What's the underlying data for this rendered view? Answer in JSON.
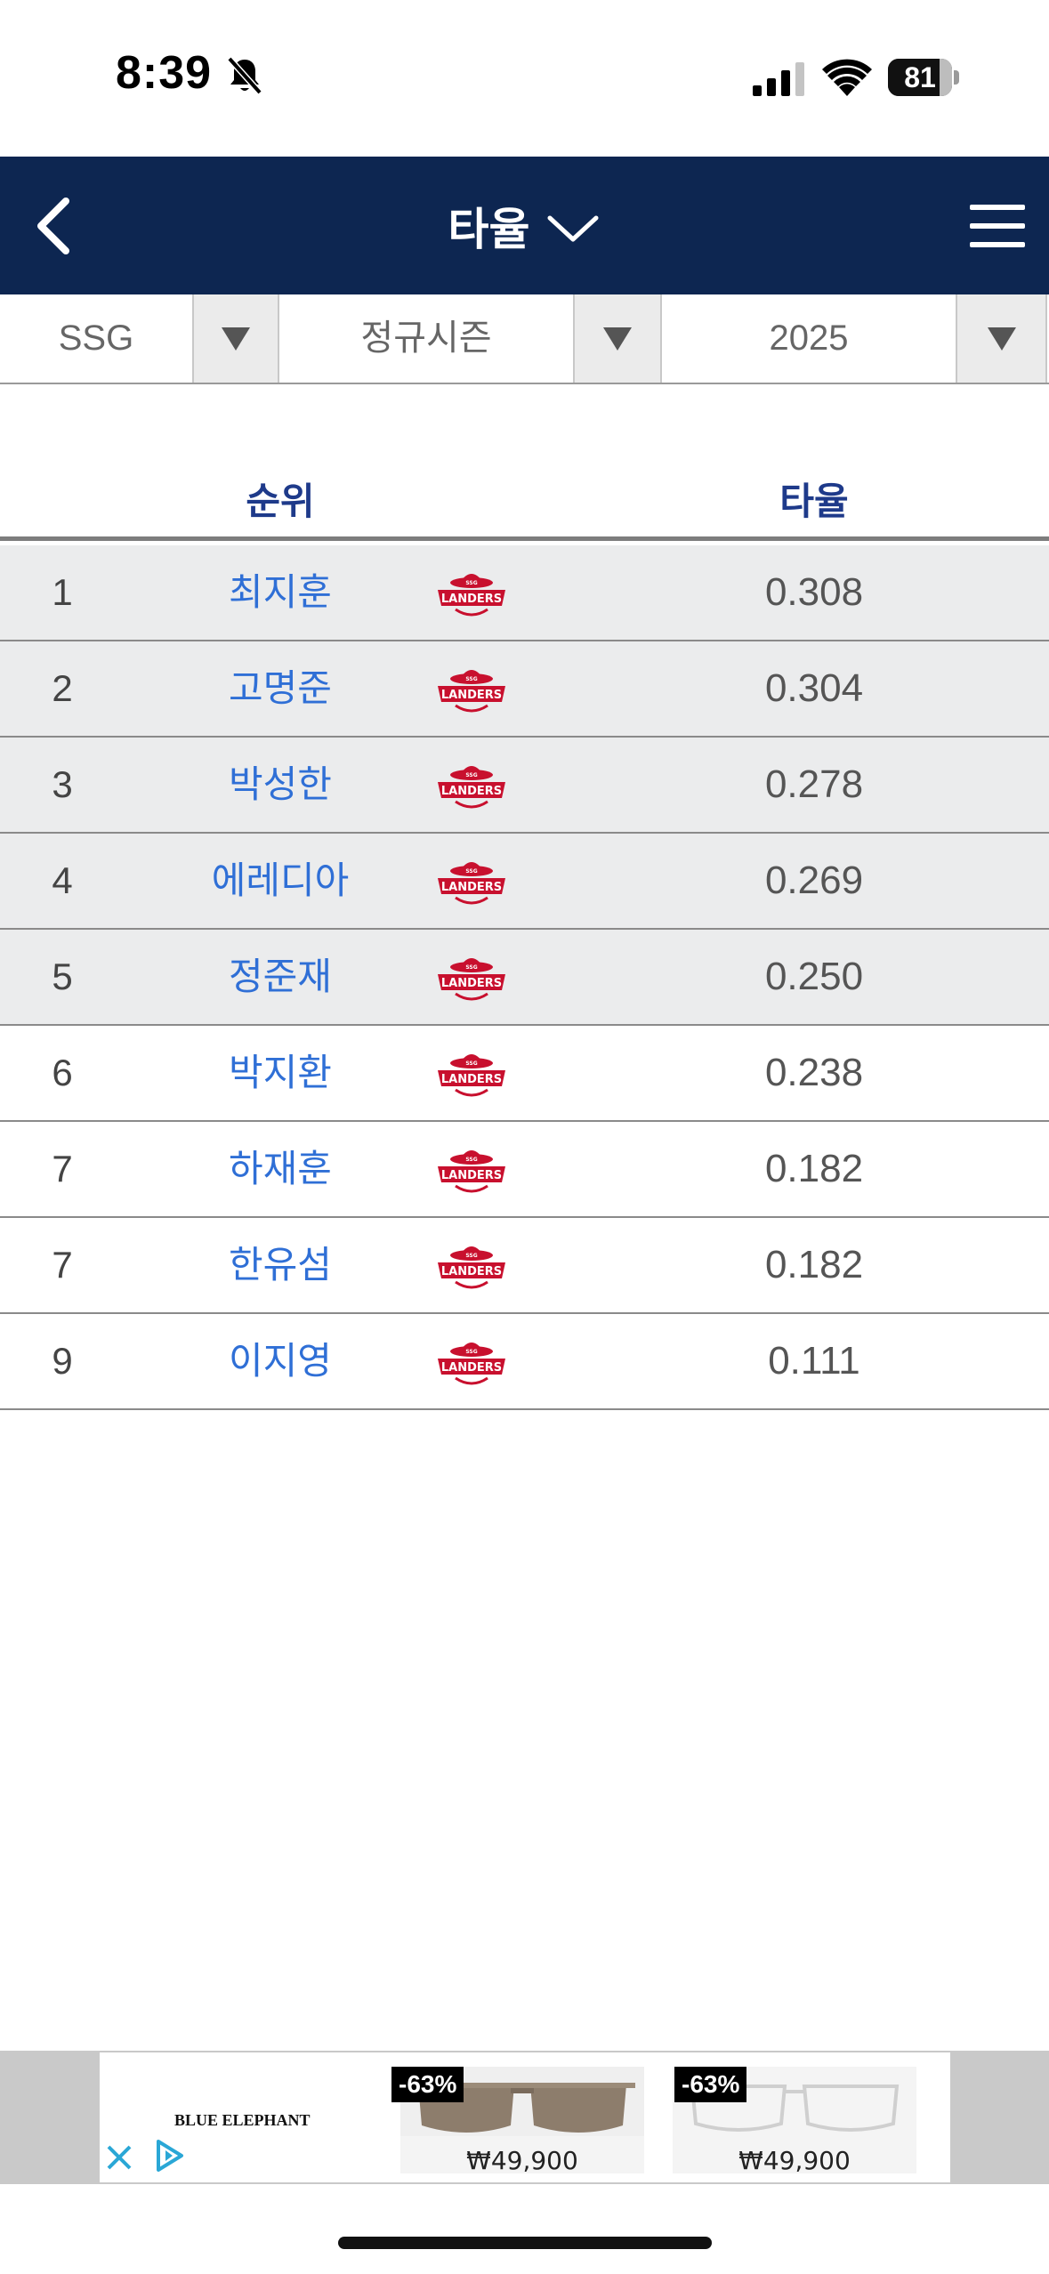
{
  "status_bar": {
    "time": "8:39",
    "battery": "81",
    "battery_level": 0.81
  },
  "header": {
    "title": "타율",
    "background": "#0d2651"
  },
  "filters": [
    {
      "label": "SSG"
    },
    {
      "label": "정규시즌"
    },
    {
      "label": "2025"
    }
  ],
  "table": {
    "headers": {
      "rank": "순위",
      "avg": "타율"
    },
    "team_logo": "ssg-landers-logo",
    "rows": [
      {
        "rank": "1",
        "name": "최지훈",
        "avg": "0.308"
      },
      {
        "rank": "2",
        "name": "고명준",
        "avg": "0.304"
      },
      {
        "rank": "3",
        "name": "박성한",
        "avg": "0.278"
      },
      {
        "rank": "4",
        "name": "에레디아",
        "avg": "0.269"
      },
      {
        "rank": "5",
        "name": "정준재",
        "avg": "0.250"
      },
      {
        "rank": "6",
        "name": "박지환",
        "avg": "0.238"
      },
      {
        "rank": "7",
        "name": "하재훈",
        "avg": "0.182"
      },
      {
        "rank": "7",
        "name": "한유섬",
        "avg": "0.182"
      },
      {
        "rank": "9",
        "name": "이지영",
        "avg": "0.111"
      }
    ]
  },
  "ad": {
    "brand": "BLUE ELEPHANT",
    "products": [
      {
        "discount": "-63%",
        "price": "₩49,900"
      },
      {
        "discount": "-63%",
        "price": "₩49,900"
      }
    ]
  }
}
